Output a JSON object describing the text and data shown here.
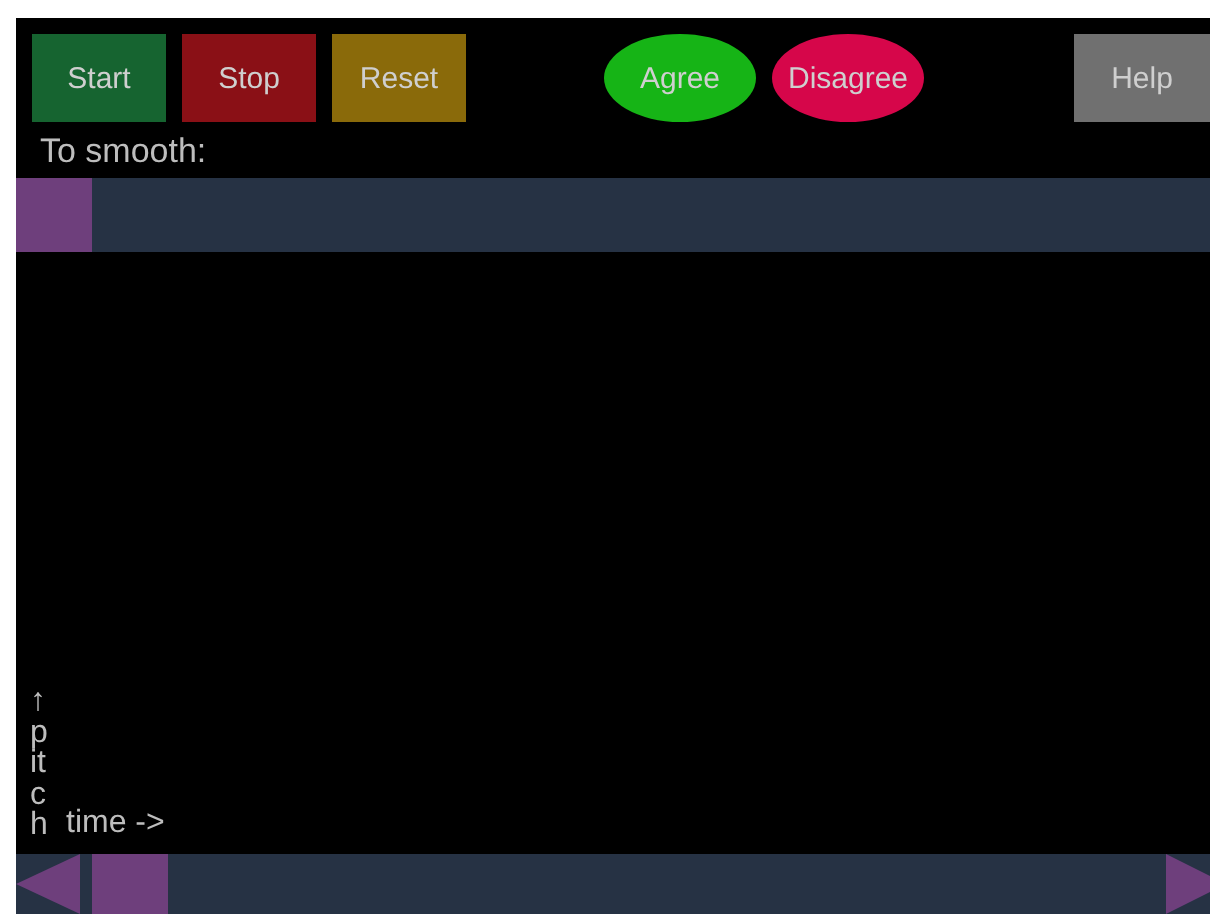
{
  "buttons": [
    {
      "label": "Start",
      "kind": "rect",
      "color": "#166430"
    },
    {
      "label": "Stop",
      "kind": "rect",
      "color": "#8a1016"
    },
    {
      "label": "Reset",
      "kind": "rect",
      "color": "#8a6a0a"
    },
    {
      "label": "Agree",
      "kind": "oval",
      "color": "#16b416"
    },
    {
      "label": "Disagree",
      "kind": "oval",
      "color": "#d6064a"
    },
    {
      "label": "Help",
      "kind": "rect",
      "color": "#707070"
    }
  ],
  "smoothing": {
    "label": "To smooth:",
    "level": 0
  },
  "plot": {
    "y_axis_label": "↑pitch",
    "x_axis_label": "time ->"
  }
}
